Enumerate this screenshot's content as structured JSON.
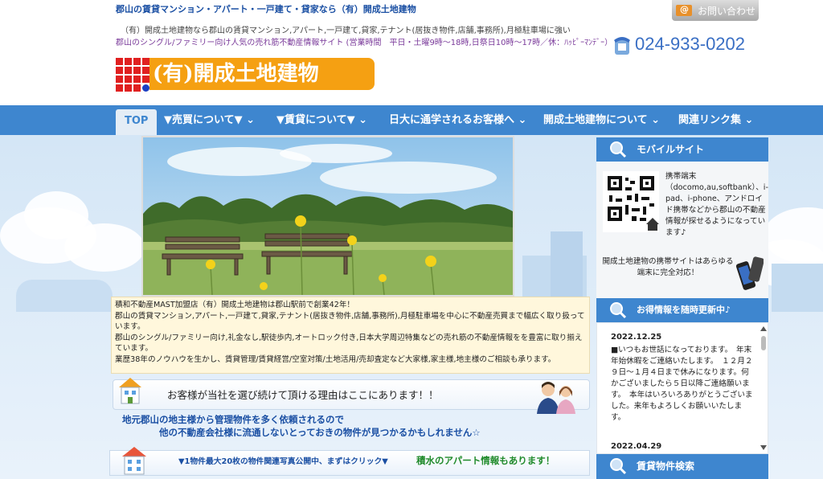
{
  "site_tagline": "郡山の賃貸マンション・アパート・一戸建て・貸家なら（有）開成土地建物",
  "contact_label": "お問い合わせ",
  "header": {
    "desc_line1": "（有）開成土地建物なら郡山の賃貸マンション,アパート,一戸建て,貸家,テナント(居抜き物件,店舗,事務所),月極駐車場に強い",
    "desc_line2": "郡山のシングル/ファミリー向け人気の売れ筋不動産情報サイト (営業時間　平日・土曜9時～18時,日祭日10時～17時／休：ﾊｯﾋﾟｰﾏﾝﾃﾞｰ）",
    "phone": "024-933-0202",
    "logo_text": "(有)開成土地建物"
  },
  "nav": [
    {
      "label": "TOP"
    },
    {
      "label": "▼売買について▼"
    },
    {
      "label": "▼賃貸について▼"
    },
    {
      "label": "日大に通学されるお客様へ"
    },
    {
      "label": "開成土地建物について"
    },
    {
      "label": "関連リンク集"
    }
  ],
  "intro": {
    "line1": "積和不動産MAST加盟店（有）開成土地建物は郡山駅前で創業42年！",
    "line2": "郡山の賃貸マンション,アパート,一戸建て,貸家,テナント(居抜き物件,店舗,事務所),月極駐車場を中心に不動産売買まで幅広く取り扱っています。",
    "line3": "郡山のシングル/ファミリー向け,礼金なし,駅徒歩内,オートロック付き,日本大学周辺特集などの売れ筋の不動産情報をを豊富に取り揃えています。",
    "line4": "業歴38年のノウハウを生かし、賃貸管理/賃貸経営/空室対策/土地活用/売却査定など大家様,家主様,地主様のご相談も承ります。"
  },
  "reason": "お客様が当社を選び続けて頂ける理由はここにあります！！",
  "owner_line1": "地元郡山の地主様から管理物件を多く依頼されるので",
  "owner_line2": "他の不動産会社様に流通しないとっておきの物件が見つかるかもしれません☆",
  "photo_link": "▼1物件最大20枚の物件関連写真公開中、まずはクリック▼",
  "sekisui": "積水のアパート情報もあります！",
  "sidebar": {
    "mobile_title": "モバイルサイト",
    "mobile_desc": "携帯端末（docomo,au,softbank）、i-pad、i-phone、アンドロイド携帯などから郡山の不動産情報が探せるようになっています♪",
    "mobile_desc2": "開成土地建物の携帯サイトはあらゆる端末に完全対応！",
    "news_title": "お得情報を随時更新中♪",
    "news_date1": "2022.12.25",
    "news_body": "■いつもお世話になっております。　年末年始休暇をご連絡いたします。　１２月２９日～１月４日まで休みになります。何かございましたら５日以降ご連絡願います。　本年はいろいろありがとうございました。来年もよろしくお願いいたします。",
    "news_date2": "2022.04.29",
    "search_title": "賃貸物件検索"
  }
}
